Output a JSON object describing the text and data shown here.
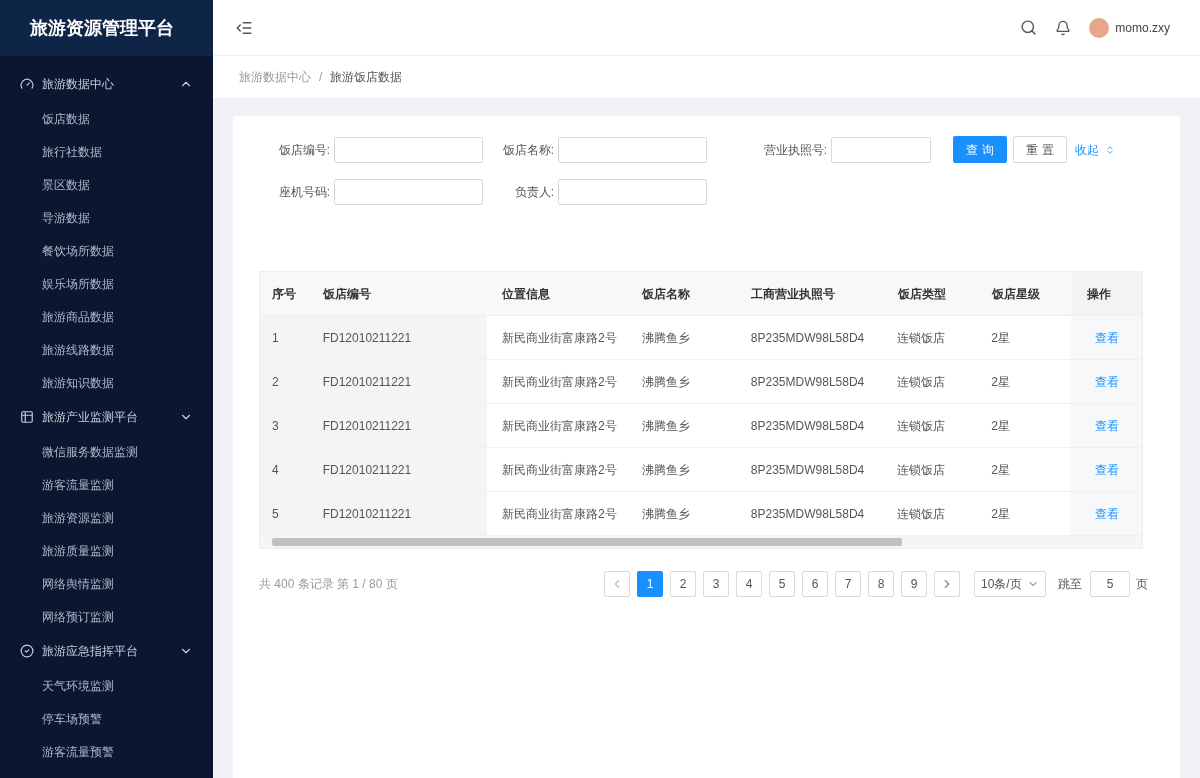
{
  "app_title": "旅游资源管理平台",
  "sidebar": {
    "groups": [
      {
        "kind": "gauge",
        "label": "旅游数据中心",
        "expanded": true,
        "children": [
          {
            "label": "饭店数据"
          },
          {
            "label": "旅行社数据"
          },
          {
            "label": "景区数据"
          },
          {
            "label": "导游数据"
          },
          {
            "label": "餐饮场所数据"
          },
          {
            "label": "娱乐场所数据"
          },
          {
            "label": "旅游商品数据"
          },
          {
            "label": "旅游线路数据"
          },
          {
            "label": "旅游知识数据"
          }
        ]
      },
      {
        "kind": "grid",
        "label": "旅游产业监测平台",
        "expanded": false,
        "children": [
          {
            "label": "微信服务数据监测"
          },
          {
            "label": "游客流量监测"
          },
          {
            "label": "旅游资源监测"
          },
          {
            "label": "旅游质量监测"
          },
          {
            "label": "网络舆情监测"
          },
          {
            "label": "网络预订监测"
          }
        ]
      },
      {
        "kind": "check",
        "label": "旅游应急指挥平台",
        "expanded": false,
        "children": [
          {
            "label": "天气环境监测"
          },
          {
            "label": "停车场预警"
          },
          {
            "label": "游客流量预警"
          }
        ]
      }
    ]
  },
  "header": {
    "user": "momo.zxy"
  },
  "breadcrumb": {
    "items": [
      "旅游数据中心",
      "旅游饭店数据"
    ],
    "separator": "/"
  },
  "filters": [
    [
      {
        "label": "饭店编号:"
      },
      {
        "label": "饭店名称:"
      },
      {
        "label": "营业执照号:"
      }
    ],
    [
      {
        "label": "座机号码:"
      },
      {
        "label": "负责人:"
      }
    ]
  ],
  "buttons": {
    "query": "查 询",
    "reset": "重 置",
    "collapse": "收起"
  },
  "table": {
    "columns": [
      "序号",
      "饭店编号",
      "位置信息",
      "饭店名称",
      "工商营业执照号",
      "饭店类型",
      "饭店星级",
      "操作"
    ],
    "rows": [
      [
        "1",
        "FD12010211221",
        "新民商业街富康路2号",
        "沸腾鱼乡",
        "8P235MDW98L58D4",
        "连锁饭店",
        "2星",
        "查看"
      ],
      [
        "2",
        "FD12010211221",
        "新民商业街富康路2号",
        "沸腾鱼乡",
        "8P235MDW98L58D4",
        "连锁饭店",
        "2星",
        "查看"
      ],
      [
        "3",
        "FD12010211221",
        "新民商业街富康路2号",
        "沸腾鱼乡",
        "8P235MDW98L58D4",
        "连锁饭店",
        "2星",
        "查看"
      ],
      [
        "4",
        "FD12010211221",
        "新民商业街富康路2号",
        "沸腾鱼乡",
        "8P235MDW98L58D4",
        "连锁饭店",
        "2星",
        "查看"
      ],
      [
        "5",
        "FD12010211221",
        "新民商业街富康路2号",
        "沸腾鱼乡",
        "8P235MDW98L58D4",
        "连锁饭店",
        "2星",
        "查看"
      ]
    ]
  },
  "pagination": {
    "summary": "共 400 条记录 第 1 / 80 页",
    "pages": [
      {
        "label": "1",
        "selected": true
      },
      {
        "label": "2",
        "selected": false
      },
      {
        "label": "3",
        "selected": false
      },
      {
        "label": "4",
        "selected": false
      },
      {
        "label": "5",
        "selected": false
      },
      {
        "label": "6",
        "selected": false
      },
      {
        "label": "7",
        "selected": false
      },
      {
        "label": "8",
        "selected": false
      },
      {
        "label": "9",
        "selected": false
      }
    ],
    "page_size": "10条/页",
    "jump_label": "跳至",
    "jump_value": "5",
    "page_unit": "页"
  }
}
